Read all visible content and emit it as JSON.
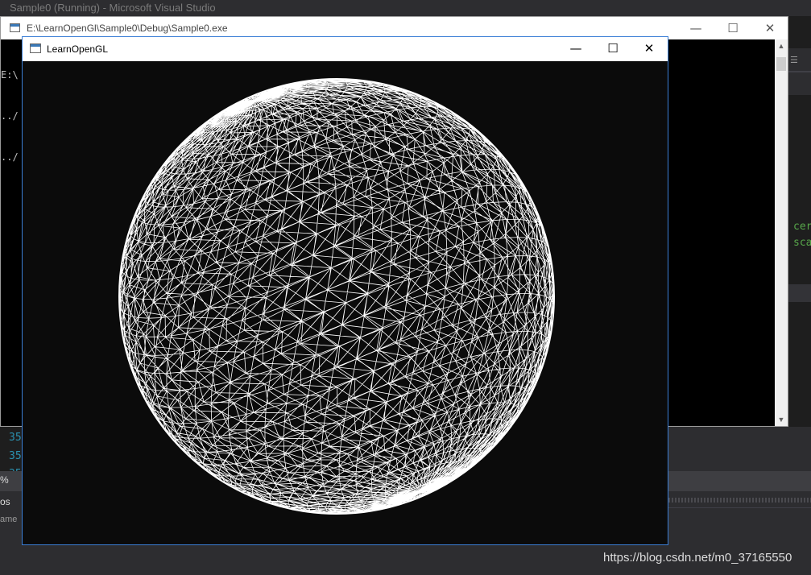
{
  "vs": {
    "title": "Sample0 (Running) - Microsoft Visual Studio",
    "right_code_lines": [
      "cer",
      "sca"
    ],
    "line_numbers": [
      "35",
      "35",
      "35"
    ],
    "strip_text": "%",
    "bottom_label_1": "os",
    "bottom_label_2": "ame",
    "header_icon": "☰"
  },
  "console": {
    "title": "E:\\LearnOpenGl\\Sample0\\Debug\\Sample0.exe",
    "lines": [
      "E:\\",
      "../",
      "../"
    ],
    "minimize": "—",
    "maximize": "☐",
    "close": "✕",
    "scroll_up": "▲",
    "scroll_down": "▼"
  },
  "gl_window": {
    "title": "LearnOpenGL",
    "minimize": "—",
    "maximize": "☐",
    "close": "✕",
    "scene": {
      "object": "wireframe sphere",
      "stroke_color": "#ffffff",
      "background": "#0b0b0b"
    }
  },
  "watermark": "https://blog.csdn.net/m0_37165550"
}
